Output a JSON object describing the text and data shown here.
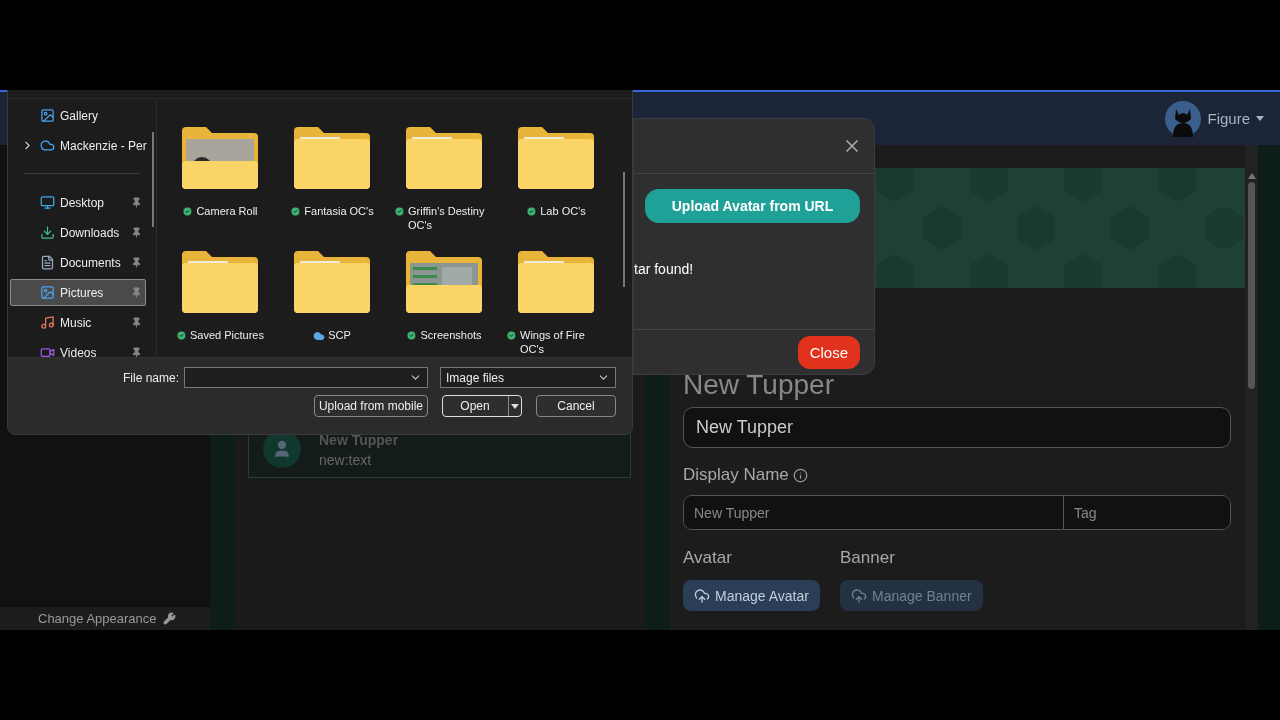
{
  "app": {
    "user": "Figure",
    "sidebar_footer": "Change Appearance",
    "tupper_card": {
      "name": "New Tupper",
      "text": "new:text"
    },
    "editor": {
      "heading": "New Tupper",
      "name_value": "New Tupper",
      "display_name_label": "Display Name",
      "display_name_placeholder": "New Tupper",
      "tag_placeholder": "Tag",
      "media_labels": [
        "Avatar",
        "Banner"
      ],
      "media_buttons": [
        {
          "label": "Manage Avatar",
          "disabled": false
        },
        {
          "label": "Manage Banner",
          "disabled": true
        }
      ]
    }
  },
  "modal": {
    "upload_button": "Upload Avatar from URL",
    "message": "tar found!",
    "close_button": "Close"
  },
  "file_dialog": {
    "nav_items": [
      {
        "label": "Gallery",
        "selected": false,
        "pinned": false,
        "expandable": false
      },
      {
        "label": "Mackenzie - Per",
        "selected": false,
        "pinned": false,
        "expandable": true
      },
      {
        "label": "Desktop",
        "selected": false,
        "pinned": true,
        "expandable": false
      },
      {
        "label": "Downloads",
        "selected": false,
        "pinned": true,
        "expandable": false
      },
      {
        "label": "Documents",
        "selected": false,
        "pinned": true,
        "expandable": false
      },
      {
        "label": "Pictures",
        "selected": true,
        "pinned": true,
        "expandable": false
      },
      {
        "label": "Music",
        "selected": false,
        "pinned": true,
        "expandable": false
      },
      {
        "label": "Videos",
        "selected": false,
        "pinned": true,
        "expandable": false
      }
    ],
    "folders": [
      {
        "name": "Camera Roll",
        "cloud_only": false,
        "has_preview": true
      },
      {
        "name": "Fantasia OC's",
        "cloud_only": false,
        "has_preview": false
      },
      {
        "name": "Griffin's Destiny OC's",
        "cloud_only": false,
        "has_preview": false
      },
      {
        "name": "Lab OC's",
        "cloud_only": false,
        "has_preview": false
      },
      {
        "name": "Saved Pictures",
        "cloud_only": false,
        "has_preview": false
      },
      {
        "name": "SCP",
        "cloud_only": true,
        "has_preview": false
      },
      {
        "name": "Screenshots",
        "cloud_only": false,
        "has_preview": true
      },
      {
        "name": "Wings of Fire OC's",
        "cloud_only": false,
        "has_preview": false
      }
    ],
    "file_name_label": "File name:",
    "file_type": "Image files",
    "buttons": [
      {
        "label": "Upload from mobile",
        "kind": "plain"
      },
      {
        "label": "Open",
        "kind": "split"
      },
      {
        "label": "Cancel",
        "kind": "plain"
      }
    ]
  }
}
